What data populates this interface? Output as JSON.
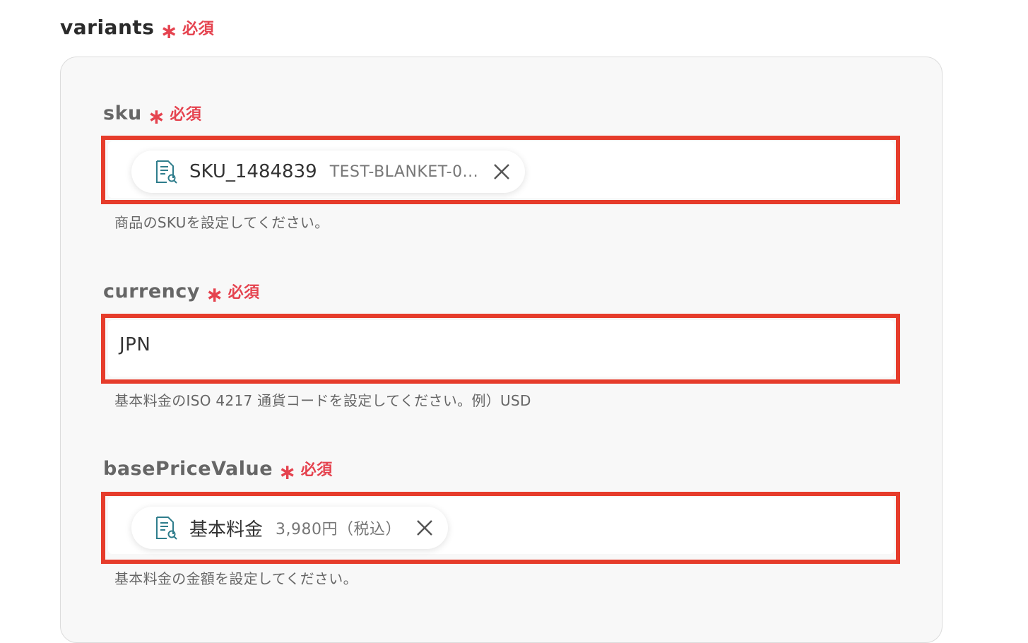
{
  "variants": {
    "title": "variants",
    "required_mark": "∗",
    "required_label": "必須"
  },
  "fields": {
    "sku": {
      "label": "sku",
      "required_mark": "∗",
      "required_label": "必須",
      "pill": {
        "name": "SKU_1484839",
        "value": "TEST-BLANKET-0...",
        "icon": "document-search-icon"
      },
      "help": "商品のSKUを設定してください。"
    },
    "currency": {
      "label": "currency",
      "required_mark": "∗",
      "required_label": "必須",
      "value": "JPN",
      "help": "基本料金のISO 4217 通貨コードを設定してください。例）USD"
    },
    "basePriceValue": {
      "label": "basePriceValue",
      "required_mark": "∗",
      "required_label": "必須",
      "pill": {
        "name": "基本料金",
        "value": "3,980円（税込）",
        "icon": "document-search-icon"
      },
      "help": "基本料金の金額を設定してください。"
    }
  },
  "colors": {
    "required": "#e5434f",
    "highlight": "#e63c2b",
    "panel_bg": "#f8f8f8",
    "icon_teal": "#2f7d8c"
  }
}
